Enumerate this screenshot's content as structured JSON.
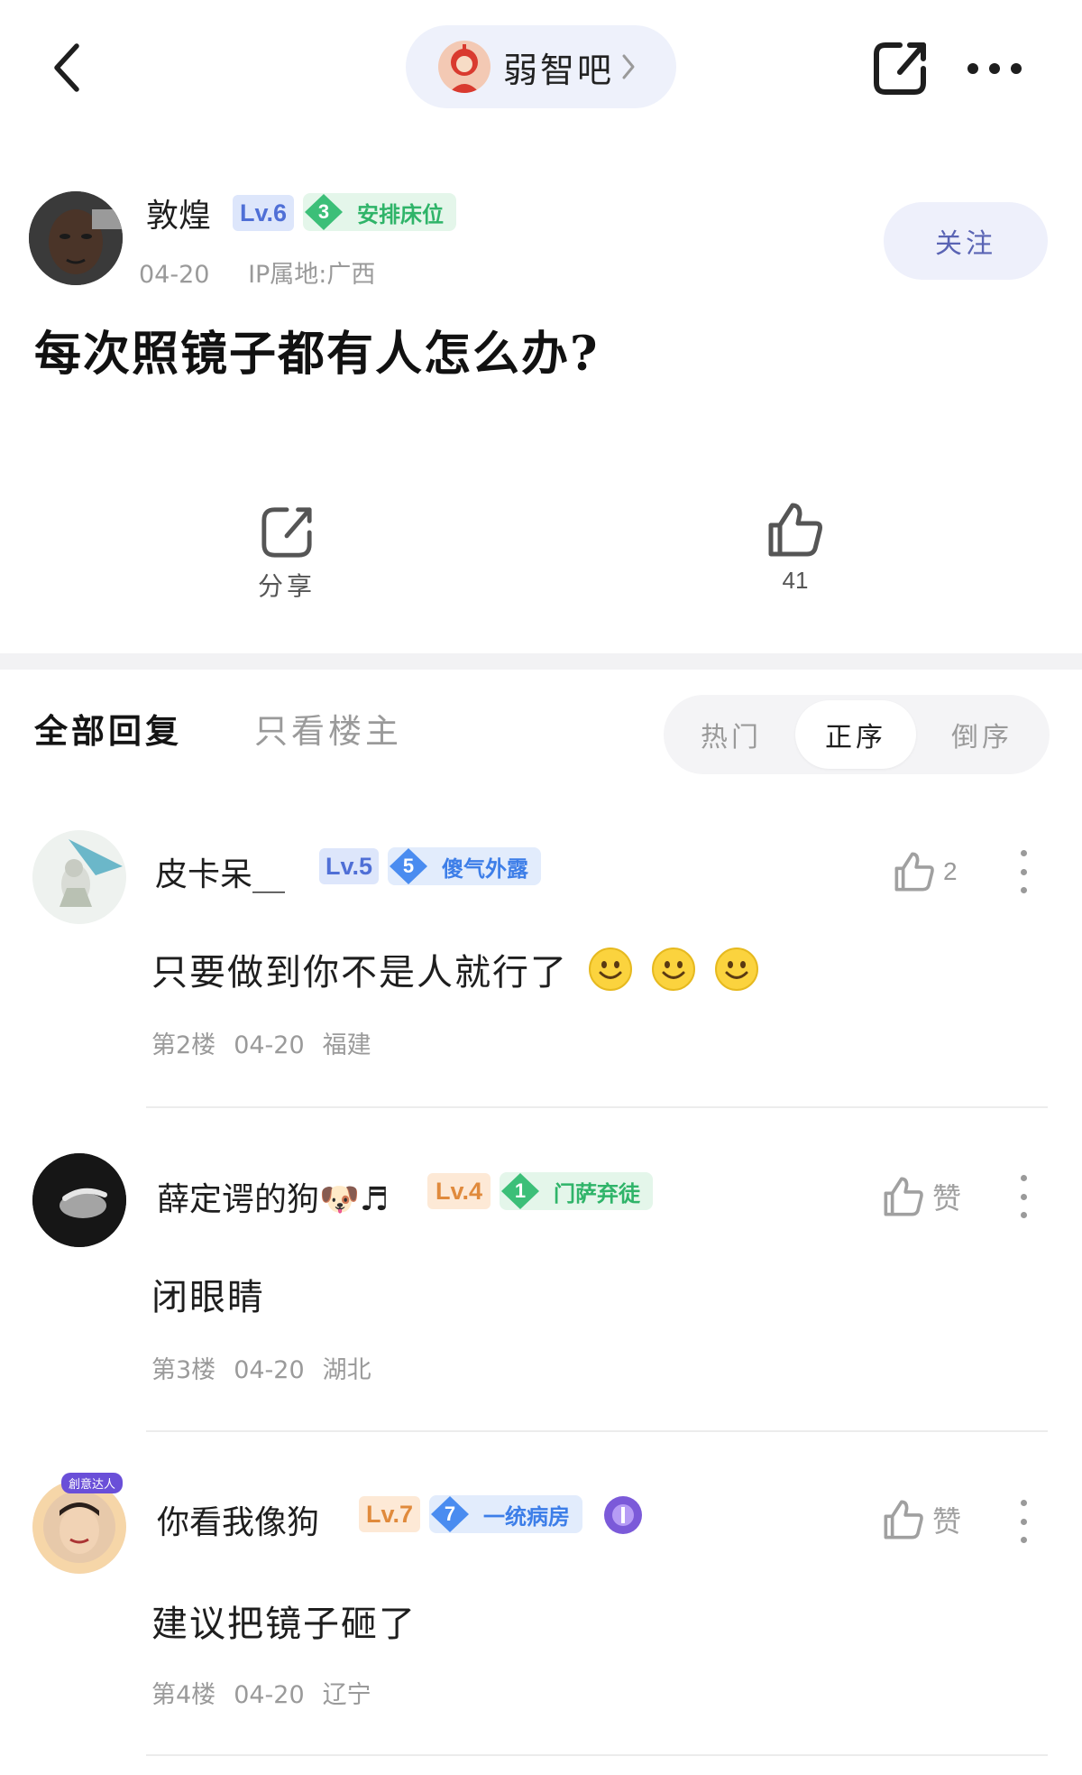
{
  "forum": {
    "name": "弱智吧"
  },
  "post": {
    "author": {
      "name": "敦煌",
      "level": "Lv.6",
      "badge_num": "3",
      "badge_title": "安排床位",
      "date": "04-20",
      "ip": "IP属地:广西"
    },
    "follow_label": "关注",
    "title": "每次照镜子都有人怎么办?",
    "share_label": "分享",
    "like_count": "41"
  },
  "tabs": {
    "all": "全部回复",
    "op_only": "只看楼主"
  },
  "sort": {
    "hot": "热门",
    "asc": "正序",
    "desc": "倒序",
    "selected": "正序"
  },
  "replies": [
    {
      "name": "皮卡呆__",
      "level": "Lv.5",
      "badge_num": "5",
      "badge_title": "傻气外露",
      "text": "只要做到你不是人就行了",
      "emoji_count": 3,
      "floor": "第2楼",
      "date": "04-20",
      "location": "福建",
      "like": "2"
    },
    {
      "name": "薛定谔的狗",
      "name_suffix": "🐶♬",
      "level": "Lv.4",
      "badge_num": "1",
      "badge_title": "门萨弃徒",
      "text": "闭眼睛",
      "floor": "第3楼",
      "date": "04-20",
      "location": "湖北",
      "like": "赞"
    },
    {
      "name": "你看我像狗",
      "level": "Lv.7",
      "badge_num": "7",
      "badge_title": "一统病房",
      "avatar_tag": "創意达人",
      "text": "建议把镜子砸了",
      "floor": "第4楼",
      "date": "04-20",
      "location": "辽宁",
      "like": "赞"
    }
  ],
  "colors": {
    "lv_blue_bg": "#dde6fb",
    "lv_blue_fg": "#4f6fd6",
    "lv_orange_bg": "#fde9d6",
    "lv_orange_fg": "#e08a3c",
    "badge_green_bg": "#e4f6ea",
    "badge_green_fg": "#2fb469",
    "badge_blue_bg": "#e2ecfc",
    "badge_blue_fg": "#3d7ee8",
    "accent_follow": "#5a64b4"
  }
}
